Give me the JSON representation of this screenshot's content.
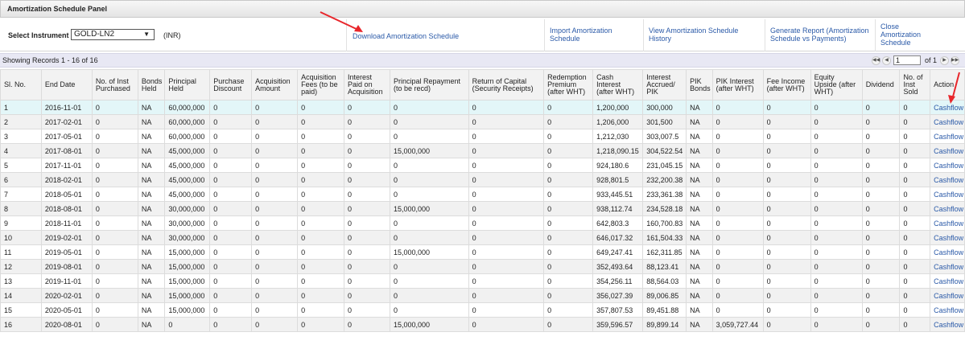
{
  "panel": {
    "title": "Amortization Schedule Panel"
  },
  "toolbar": {
    "select_label": "Select Instrument",
    "instrument": "GOLD-LN2",
    "currency": "(INR)",
    "links": {
      "download": "Download Amortization Schedule",
      "import_line1": "Import Amortization",
      "import_line2": "Schedule",
      "history_line1": "View Amortization Schedule",
      "history_line2": "History",
      "report_line1": "Generate Report (Amortization",
      "report_line2": "Schedule vs Payments)",
      "close_line1": "Close",
      "close_line2": "Amortization",
      "close_line3": "Schedule"
    }
  },
  "records": {
    "text": "Showing Records 1 - 16 of 16",
    "page": "1",
    "of_pages": "of 1"
  },
  "table": {
    "headers": [
      "Sl. No.",
      "End Date",
      "No. of Inst Purchased",
      "Bonds Held",
      "Principal Held",
      "Purchase Discount",
      "Acquisition Amount",
      "Acquisition Fees (to be paid)",
      "Interest Paid on Acquisition",
      "Principal Repayment (to be recd)",
      "Return of Capital (Security Receipts)",
      "Redemption Premium (after WHT)",
      "Cash Interest (after WHT)",
      "Interest Accrued/ PIK",
      "PIK Bonds",
      "PIK Interest (after WHT)",
      "Fee Income (after WHT)",
      "Equity Upside (after WHT)",
      "Dividend",
      "No. of Inst Sold",
      "Action"
    ],
    "rows": [
      [
        "1",
        "2016-11-01",
        "0",
        "NA",
        "60,000,000",
        "0",
        "0",
        "0",
        "0",
        "0",
        "0",
        "0",
        "1,200,000",
        "300,000",
        "NA",
        "0",
        "0",
        "0",
        "0",
        "0",
        "Cashflow"
      ],
      [
        "2",
        "2017-02-01",
        "0",
        "NA",
        "60,000,000",
        "0",
        "0",
        "0",
        "0",
        "0",
        "0",
        "0",
        "1,206,000",
        "301,500",
        "NA",
        "0",
        "0",
        "0",
        "0",
        "0",
        "Cashflow"
      ],
      [
        "3",
        "2017-05-01",
        "0",
        "NA",
        "60,000,000",
        "0",
        "0",
        "0",
        "0",
        "0",
        "0",
        "0",
        "1,212,030",
        "303,007.5",
        "NA",
        "0",
        "0",
        "0",
        "0",
        "0",
        "Cashflow"
      ],
      [
        "4",
        "2017-08-01",
        "0",
        "NA",
        "45,000,000",
        "0",
        "0",
        "0",
        "0",
        "15,000,000",
        "0",
        "0",
        "1,218,090.15",
        "304,522.54",
        "NA",
        "0",
        "0",
        "0",
        "0",
        "0",
        "Cashflow"
      ],
      [
        "5",
        "2017-11-01",
        "0",
        "NA",
        "45,000,000",
        "0",
        "0",
        "0",
        "0",
        "0",
        "0",
        "0",
        "924,180.6",
        "231,045.15",
        "NA",
        "0",
        "0",
        "0",
        "0",
        "0",
        "Cashflow"
      ],
      [
        "6",
        "2018-02-01",
        "0",
        "NA",
        "45,000,000",
        "0",
        "0",
        "0",
        "0",
        "0",
        "0",
        "0",
        "928,801.5",
        "232,200.38",
        "NA",
        "0",
        "0",
        "0",
        "0",
        "0",
        "Cashflow"
      ],
      [
        "7",
        "2018-05-01",
        "0",
        "NA",
        "45,000,000",
        "0",
        "0",
        "0",
        "0",
        "0",
        "0",
        "0",
        "933,445.51",
        "233,361.38",
        "NA",
        "0",
        "0",
        "0",
        "0",
        "0",
        "Cashflow"
      ],
      [
        "8",
        "2018-08-01",
        "0",
        "NA",
        "30,000,000",
        "0",
        "0",
        "0",
        "0",
        "15,000,000",
        "0",
        "0",
        "938,112.74",
        "234,528.18",
        "NA",
        "0",
        "0",
        "0",
        "0",
        "0",
        "Cashflow"
      ],
      [
        "9",
        "2018-11-01",
        "0",
        "NA",
        "30,000,000",
        "0",
        "0",
        "0",
        "0",
        "0",
        "0",
        "0",
        "642,803.3",
        "160,700.83",
        "NA",
        "0",
        "0",
        "0",
        "0",
        "0",
        "Cashflow"
      ],
      [
        "10",
        "2019-02-01",
        "0",
        "NA",
        "30,000,000",
        "0",
        "0",
        "0",
        "0",
        "0",
        "0",
        "0",
        "646,017.32",
        "161,504.33",
        "NA",
        "0",
        "0",
        "0",
        "0",
        "0",
        "Cashflow"
      ],
      [
        "11",
        "2019-05-01",
        "0",
        "NA",
        "15,000,000",
        "0",
        "0",
        "0",
        "0",
        "15,000,000",
        "0",
        "0",
        "649,247.41",
        "162,311.85",
        "NA",
        "0",
        "0",
        "0",
        "0",
        "0",
        "Cashflow"
      ],
      [
        "12",
        "2019-08-01",
        "0",
        "NA",
        "15,000,000",
        "0",
        "0",
        "0",
        "0",
        "0",
        "0",
        "0",
        "352,493.64",
        "88,123.41",
        "NA",
        "0",
        "0",
        "0",
        "0",
        "0",
        "Cashflow"
      ],
      [
        "13",
        "2019-11-01",
        "0",
        "NA",
        "15,000,000",
        "0",
        "0",
        "0",
        "0",
        "0",
        "0",
        "0",
        "354,256.11",
        "88,564.03",
        "NA",
        "0",
        "0",
        "0",
        "0",
        "0",
        "Cashflow"
      ],
      [
        "14",
        "2020-02-01",
        "0",
        "NA",
        "15,000,000",
        "0",
        "0",
        "0",
        "0",
        "0",
        "0",
        "0",
        "356,027.39",
        "89,006.85",
        "NA",
        "0",
        "0",
        "0",
        "0",
        "0",
        "Cashflow"
      ],
      [
        "15",
        "2020-05-01",
        "0",
        "NA",
        "15,000,000",
        "0",
        "0",
        "0",
        "0",
        "0",
        "0",
        "0",
        "357,807.53",
        "89,451.88",
        "NA",
        "0",
        "0",
        "0",
        "0",
        "0",
        "Cashflow"
      ],
      [
        "16",
        "2020-08-01",
        "0",
        "NA",
        "0",
        "0",
        "0",
        "0",
        "0",
        "15,000,000",
        "0",
        "0",
        "359,596.57",
        "89,899.14",
        "NA",
        "3,059,727.44",
        "0",
        "0",
        "0",
        "0",
        "Cashflow"
      ]
    ]
  },
  "colors": {
    "link": "#2b5aa8",
    "annotation_arrow": "#e8262b",
    "first_row_highlight": "#e3f6f8",
    "records_bar": "#e8e8f4"
  },
  "icons": {
    "select_arrow": "dropdown-arrow-icon",
    "pager": [
      "first-page-icon",
      "prev-page-icon",
      "next-page-icon",
      "last-page-icon"
    ],
    "annotations": [
      "red-arrow-icon"
    ]
  }
}
